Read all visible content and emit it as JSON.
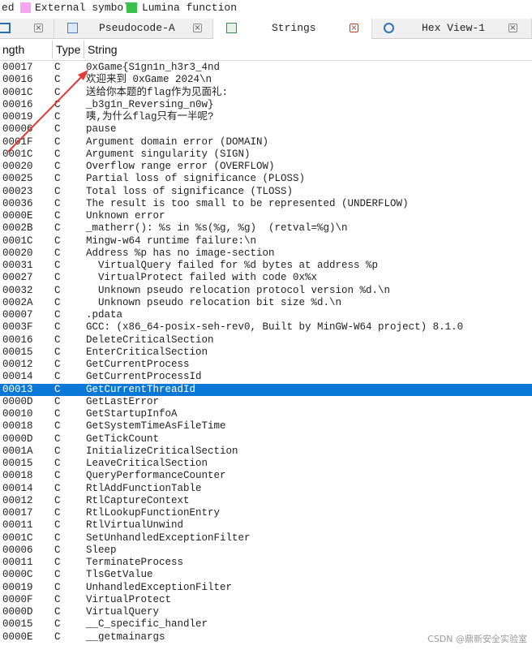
{
  "legend": {
    "cut_text": "ed",
    "items": [
      {
        "label": "External symbol",
        "color": "#f4a6f0"
      },
      {
        "label": "Lumina function",
        "color": "#39c04a"
      }
    ]
  },
  "tabs": [
    {
      "label": "",
      "icon": "tab-icon"
    },
    {
      "label": "Pseudocode-A",
      "icon": "pseudocode-icon"
    },
    {
      "label": "Strings",
      "icon": "strings-icon",
      "active": true
    },
    {
      "label": "Hex View-1",
      "icon": "hex-view-icon"
    }
  ],
  "header": {
    "length": "ngth",
    "type": "Type",
    "string": "String"
  },
  "selected_color": "#0a78d7",
  "rows": [
    {
      "len": "00017",
      "type": "C",
      "str": "0xGame{S1gn1n_h3r3_4nd"
    },
    {
      "len": "00016",
      "type": "C",
      "str": "欢迎来到 0xGame 2024\\n"
    },
    {
      "len": "0001C",
      "type": "C",
      "str": "送给你本题的flag作为见面礼:"
    },
    {
      "len": "00016",
      "type": "C",
      "str": "_b3g1n_Reversing_n0w}"
    },
    {
      "len": "00019",
      "type": "C",
      "str": "咦,为什么flag只有一半呢?"
    },
    {
      "len": "00006",
      "type": "C",
      "str": "pause"
    },
    {
      "len": "0001F",
      "type": "C",
      "str": "Argument domain error (DOMAIN)"
    },
    {
      "len": "0001C",
      "type": "C",
      "str": "Argument singularity (SIGN)"
    },
    {
      "len": "00020",
      "type": "C",
      "str": "Overflow range error (OVERFLOW)"
    },
    {
      "len": "00025",
      "type": "C",
      "str": "Partial loss of significance (PLOSS)"
    },
    {
      "len": "00023",
      "type": "C",
      "str": "Total loss of significance (TLOSS)"
    },
    {
      "len": "00036",
      "type": "C",
      "str": "The result is too small to be represented (UNDERFLOW)"
    },
    {
      "len": "0000E",
      "type": "C",
      "str": "Unknown error"
    },
    {
      "len": "0002B",
      "type": "C",
      "str": "_matherr(): %s in %s(%g, %g)  (retval=%g)\\n"
    },
    {
      "len": "0001C",
      "type": "C",
      "str": "Mingw-w64 runtime failure:\\n"
    },
    {
      "len": "00020",
      "type": "C",
      "str": "Address %p has no image-section"
    },
    {
      "len": "00031",
      "type": "C",
      "str": "  VirtualQuery failed for %d bytes at address %p"
    },
    {
      "len": "00027",
      "type": "C",
      "str": "  VirtualProtect failed with code 0x%x"
    },
    {
      "len": "00032",
      "type": "C",
      "str": "  Unknown pseudo relocation protocol version %d.\\n"
    },
    {
      "len": "0002A",
      "type": "C",
      "str": "  Unknown pseudo relocation bit size %d.\\n"
    },
    {
      "len": "00007",
      "type": "C",
      "str": ".pdata"
    },
    {
      "len": "0003F",
      "type": "C",
      "str": "GCC: (x86_64-posix-seh-rev0, Built by MinGW-W64 project) 8.1.0"
    },
    {
      "len": "00016",
      "type": "C",
      "str": "DeleteCriticalSection"
    },
    {
      "len": "00015",
      "type": "C",
      "str": "EnterCriticalSection"
    },
    {
      "len": "00012",
      "type": "C",
      "str": "GetCurrentProcess"
    },
    {
      "len": "00014",
      "type": "C",
      "str": "GetCurrentProcessId"
    },
    {
      "len": "00013",
      "type": "C",
      "str": "GetCurrentThreadId",
      "selected": true
    },
    {
      "len": "0000D",
      "type": "C",
      "str": "GetLastError"
    },
    {
      "len": "00010",
      "type": "C",
      "str": "GetStartupInfoA"
    },
    {
      "len": "00018",
      "type": "C",
      "str": "GetSystemTimeAsFileTime"
    },
    {
      "len": "0000D",
      "type": "C",
      "str": "GetTickCount"
    },
    {
      "len": "0001A",
      "type": "C",
      "str": "InitializeCriticalSection"
    },
    {
      "len": "00015",
      "type": "C",
      "str": "LeaveCriticalSection"
    },
    {
      "len": "00018",
      "type": "C",
      "str": "QueryPerformanceCounter"
    },
    {
      "len": "00014",
      "type": "C",
      "str": "RtlAddFunctionTable"
    },
    {
      "len": "00012",
      "type": "C",
      "str": "RtlCaptureContext"
    },
    {
      "len": "00017",
      "type": "C",
      "str": "RtlLookupFunctionEntry"
    },
    {
      "len": "00011",
      "type": "C",
      "str": "RtlVirtualUnwind"
    },
    {
      "len": "0001C",
      "type": "C",
      "str": "SetUnhandledExceptionFilter"
    },
    {
      "len": "00006",
      "type": "C",
      "str": "Sleep"
    },
    {
      "len": "00011",
      "type": "C",
      "str": "TerminateProcess"
    },
    {
      "len": "0000C",
      "type": "C",
      "str": "TlsGetValue"
    },
    {
      "len": "00019",
      "type": "C",
      "str": "UnhandledExceptionFilter"
    },
    {
      "len": "0000F",
      "type": "C",
      "str": "VirtualProtect"
    },
    {
      "len": "0000D",
      "type": "C",
      "str": "VirtualQuery"
    },
    {
      "len": "00015",
      "type": "C",
      "str": "__C_specific_handler"
    },
    {
      "len": "0000E",
      "type": "C",
      "str": "__getmainargs"
    }
  ],
  "watermark": "CSDN @鼎新安全实验室",
  "annotation_color": "#e53935"
}
